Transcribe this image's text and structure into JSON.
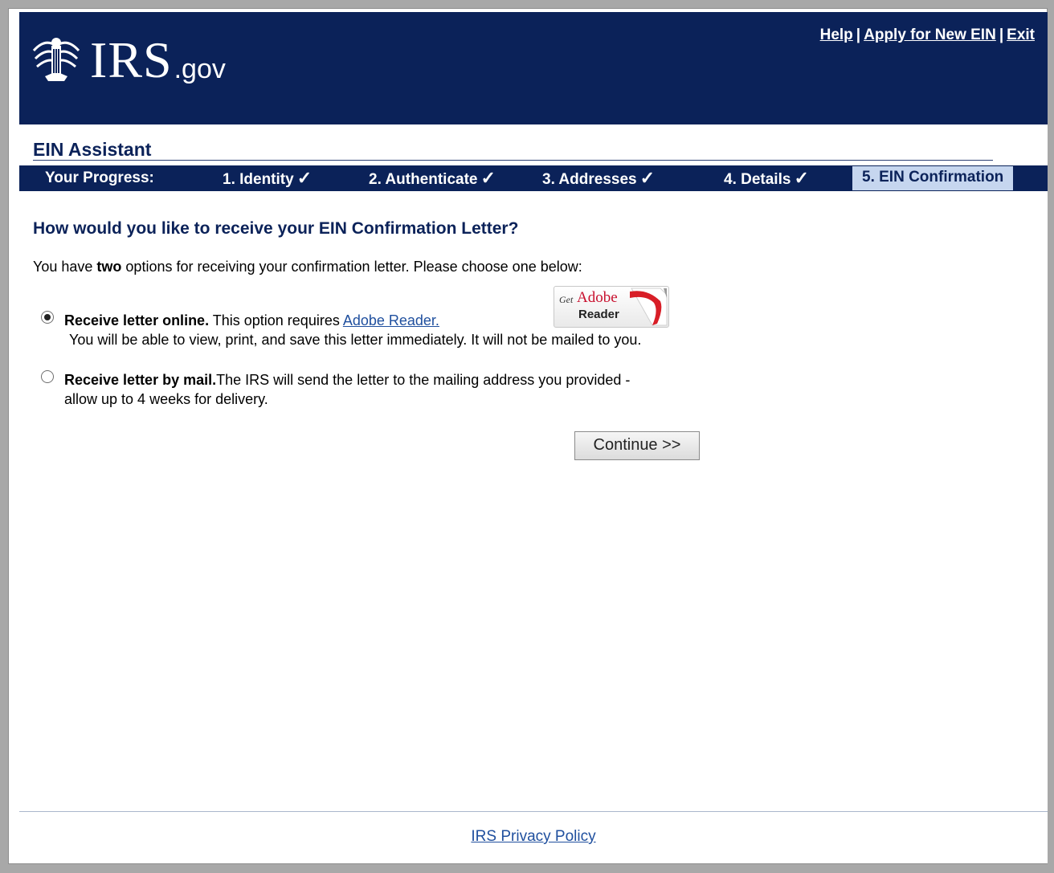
{
  "header": {
    "logo_main": "IRS",
    "logo_suffix": ".gov",
    "links": [
      "Help",
      "Apply for New EIN",
      "Exit"
    ],
    "separator": "|"
  },
  "assistant_title": "EIN Assistant",
  "progress": {
    "label": "Your Progress:",
    "steps": [
      {
        "label": "1. Identity",
        "done": true
      },
      {
        "label": "2. Authenticate",
        "done": true
      },
      {
        "label": "3. Addresses",
        "done": true
      },
      {
        "label": "4. Details",
        "done": true
      },
      {
        "label": "5. EIN Confirmation",
        "done": false,
        "current": true
      }
    ],
    "check_glyph": "✓"
  },
  "question": "How would you like to receive your EIN Confirmation Letter?",
  "intro": {
    "before": "You have ",
    "bold": "two",
    "after": " options for receiving your confirmation letter. Please choose one below:"
  },
  "options": {
    "online": {
      "selected": true,
      "bold": "Receive letter online.",
      "text": " This option requires ",
      "link": "Adobe Reader.",
      "line2": "You will be able to view, print, and save this letter immediately. It will not be mailed to you."
    },
    "mail": {
      "selected": false,
      "bold": "Receive letter by mail.",
      "text": "The IRS will send the letter to the mailing address you provided -",
      "line2": "allow up to 4 weeks for delivery."
    }
  },
  "adobe_badge": {
    "get": "Get",
    "brand": "Adobe",
    "product": "Reader"
  },
  "continue_label": "Continue >>",
  "footer_link": "IRS Privacy Policy",
  "colors": {
    "navy": "#0b2259",
    "current_step_bg": "#c6d6ef",
    "link": "#1f4f9e",
    "adobe_red": "#c8102e"
  }
}
